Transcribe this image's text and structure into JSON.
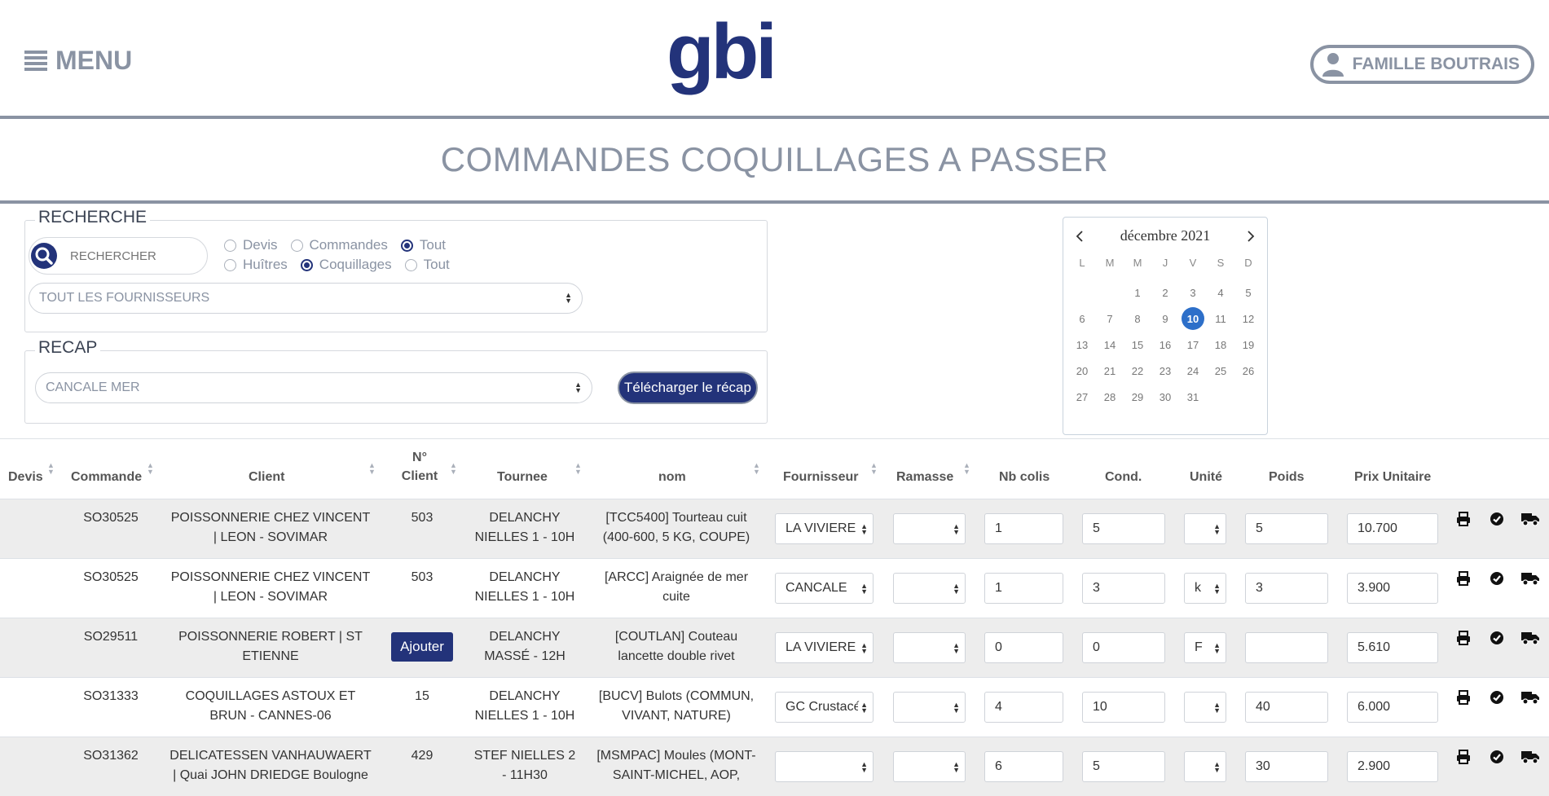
{
  "header": {
    "menu_label": "MENU",
    "logo_text": "gbi",
    "user_label": "FAMILLE BOUTRAIS"
  },
  "page_title": "COMMANDES COQUILLAGES A PASSER",
  "recherche": {
    "legend": "RECHERCHE",
    "search_placeholder": "RECHERCHER",
    "type_options": [
      "Devis",
      "Commandes",
      "Tout"
    ],
    "type_selected": "Tout",
    "product_options": [
      "Huîtres",
      "Coquillages",
      "Tout"
    ],
    "product_selected": "Coquillages",
    "supplier_select": "TOUT LES FOURNISSEURS"
  },
  "recap": {
    "legend": "RECAP",
    "select_value": "CANCALE MER",
    "download_label": "Télécharger le récap"
  },
  "calendar": {
    "month_label": "décembre 2021",
    "weekdays": [
      "L",
      "M",
      "M",
      "J",
      "V",
      "S",
      "D"
    ],
    "leading_blanks": 2,
    "days": 31,
    "selected_day": 10
  },
  "table": {
    "headers": {
      "devis": "Devis",
      "commande": "Commande",
      "client": "Client",
      "no_client_1": "N°",
      "no_client_2": "Client",
      "tournee": "Tournee",
      "nom": "nom",
      "fournisseur": "Fournisseur",
      "ramasse": "Ramasse",
      "nb_colis": "Nb colis",
      "cond": "Cond.",
      "unite": "Unité",
      "poids": "Poids",
      "prix": "Prix Unitaire"
    },
    "add_label": "Ajouter",
    "rows": [
      {
        "commande": "SO30525",
        "client_1": "POISSONNERIE CHEZ VINCENT",
        "client_2": "| LEON - SOVIMAR",
        "no_client": "503",
        "tournee_1": "DELANCHY",
        "tournee_2": "NIELLES 1 - 10H",
        "nom_1": "[TCC5400] Tourteau cuit",
        "nom_2": "(400-600, 5 KG, COUPE)",
        "fournisseur": "LA VIVIERE",
        "ramasse": "",
        "nb_colis": "1",
        "cond": "5",
        "unite": "",
        "poids": "5",
        "prix": "10.700"
      },
      {
        "commande": "SO30525",
        "client_1": "POISSONNERIE CHEZ VINCENT",
        "client_2": "| LEON - SOVIMAR",
        "no_client": "503",
        "tournee_1": "DELANCHY",
        "tournee_2": "NIELLES 1 - 10H",
        "nom_1": "[ARCC] Araignée de mer",
        "nom_2": "cuite",
        "fournisseur": "CANCALE",
        "ramasse": "",
        "nb_colis": "1",
        "cond": "3",
        "unite": "k",
        "poids": "3",
        "prix": "3.900"
      },
      {
        "commande": "SO29511",
        "client_1": "POISSONNERIE ROBERT | ST",
        "client_2": "ETIENNE",
        "no_client": "",
        "tournee_1": "DELANCHY",
        "tournee_2": "MASSÉ - 12H",
        "nom_1": "[COUTLAN] Couteau",
        "nom_2": "lancette double rivet",
        "fournisseur": "LA VIVIERE",
        "ramasse": "",
        "nb_colis": "0",
        "cond": "0",
        "unite": "F",
        "poids": "",
        "prix": "5.610"
      },
      {
        "commande": "SO31333",
        "client_1": "COQUILLAGES ASTOUX ET",
        "client_2": "BRUN - CANNES-06",
        "no_client": "15",
        "tournee_1": "DELANCHY",
        "tournee_2": "NIELLES 1 - 10H",
        "nom_1": "[BUCV] Bulots (COMMUN,",
        "nom_2": "VIVANT, NATURE)",
        "fournisseur": "GC Crustacés",
        "ramasse": "",
        "nb_colis": "4",
        "cond": "10",
        "unite": "",
        "poids": "40",
        "prix": "6.000"
      },
      {
        "commande": "SO31362",
        "client_1": "DELICATESSEN VANHAUWAERT",
        "client_2": "| Quai JOHN DRIEDGE Boulogne",
        "no_client": "429",
        "tournee_1": "STEF NIELLES 2",
        "tournee_2": "- 11H30",
        "nom_1": "[MSMPAC] Moules (MONT-",
        "nom_2": "SAINT-MICHEL, AOP,",
        "fournisseur": "",
        "ramasse": "",
        "nb_colis": "6",
        "cond": "5",
        "unite": "",
        "poids": "30",
        "prix": "2.900"
      }
    ]
  },
  "icons": {
    "menu": "hamburger-icon",
    "user": "user-icon",
    "search": "search-icon",
    "print": "print-icon",
    "validate": "check-circle-icon",
    "delivery": "truck-icon"
  },
  "colors": {
    "brand_navy": "#23337a",
    "gray_text": "#8a93a3",
    "calendar_selected": "#2d6fc9",
    "row_alt": "#ededed"
  }
}
